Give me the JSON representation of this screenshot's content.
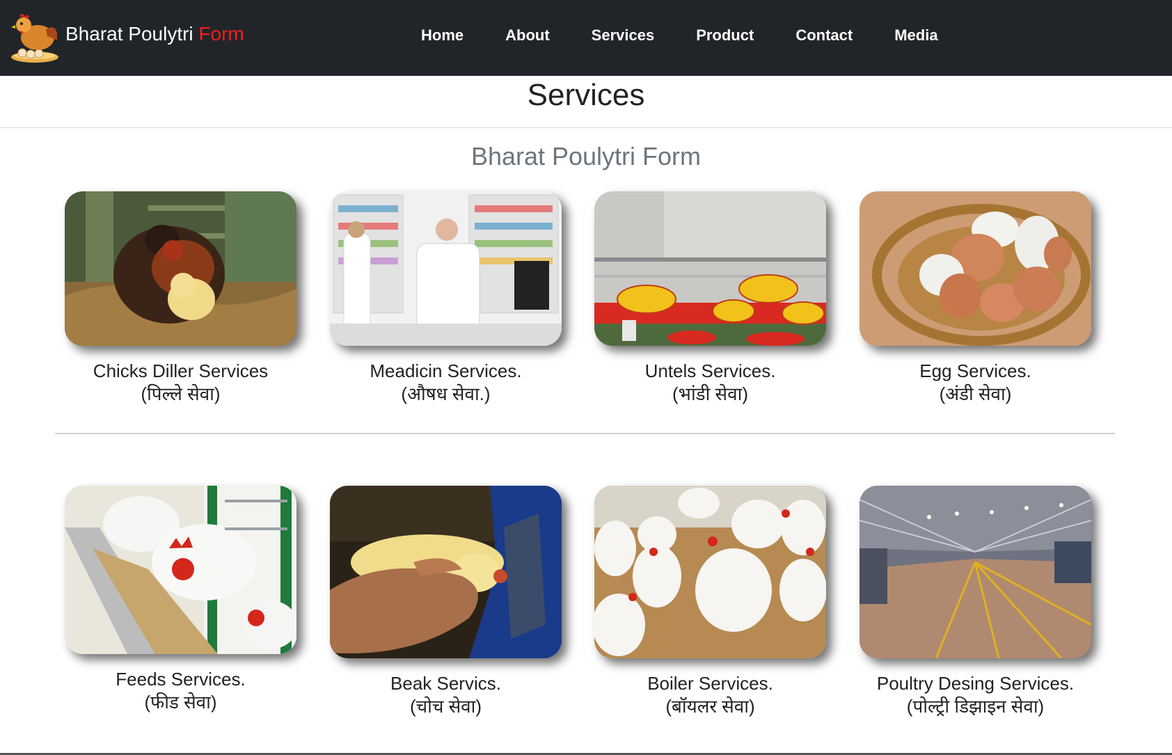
{
  "header": {
    "brand_main": "Bharat Poulytri ",
    "brand_accent": "Form",
    "nav": [
      "Home",
      "About",
      "Services",
      "Product",
      "Contact",
      "Media"
    ]
  },
  "page": {
    "title": "Services",
    "subtitle": "Bharat Poulytri Form"
  },
  "services": [
    {
      "title": "Chicks Diller Services",
      "subtitle": "(पिल्ले सेवा)"
    },
    {
      "title": "Meadicin Services.",
      "subtitle": "(औषध सेवा.)"
    },
    {
      "title": "Untels Services.",
      "subtitle": "(भांडी सेवा)"
    },
    {
      "title": "Egg Services.",
      "subtitle": "(अंडी सेवा)"
    },
    {
      "title": "Feeds Services.",
      "subtitle": "(फीड सेवा)"
    },
    {
      "title": "Beak Servics.",
      "subtitle": "(चोच सेवा)"
    },
    {
      "title": "Boiler Services.",
      "subtitle": "(बॉयलर सेवा)"
    },
    {
      "title": "Poultry Desing Services.",
      "subtitle": "(पोल्ट्री डिझाइन सेवा)"
    }
  ]
}
